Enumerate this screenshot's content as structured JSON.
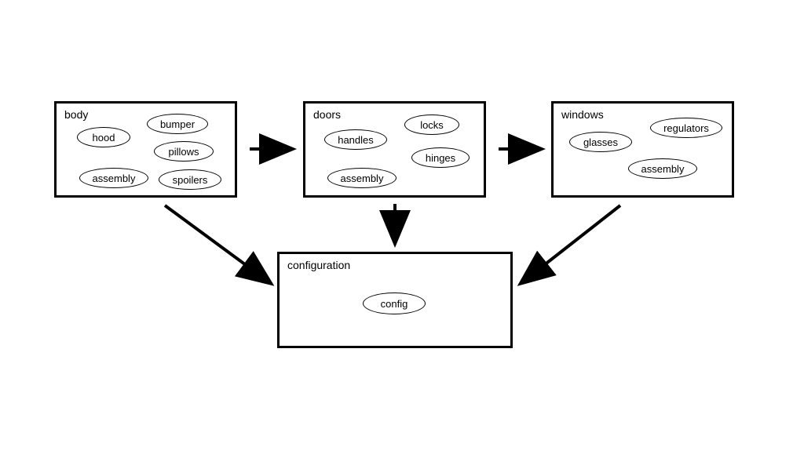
{
  "boxes": {
    "body": {
      "title": "body",
      "nodes": {
        "hood": "hood",
        "bumper": "bumper",
        "pillows": "pillows",
        "assembly": "assembly",
        "spoilers": "spoilers"
      }
    },
    "doors": {
      "title": "doors",
      "nodes": {
        "handles": "handles",
        "locks": "locks",
        "assembly": "assembly",
        "hinges": "hinges"
      }
    },
    "windows": {
      "title": "windows",
      "nodes": {
        "glasses": "glasses",
        "regulators": "regulators",
        "assembly": "assembly"
      }
    },
    "configuration": {
      "title": "configuration",
      "nodes": {
        "config": "config"
      }
    }
  }
}
